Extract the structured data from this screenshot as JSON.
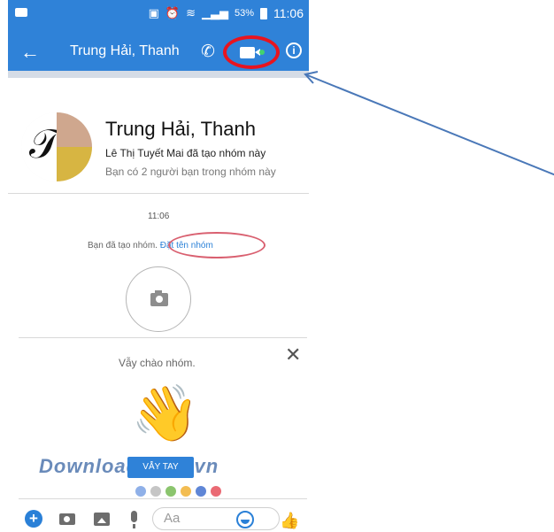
{
  "status_bar": {
    "battery": "53%",
    "time": "11:06"
  },
  "header": {
    "title": "Trung Hải, Thanh",
    "back_icon": "arrow-left",
    "phone_icon": "phone",
    "video_icon": "video-camera",
    "info_icon": "info"
  },
  "group": {
    "name": "Trung Hải, Thanh",
    "creator_note": "Lê Thị Tuyết Mai đã tạo nhóm này",
    "friends_note": "Bạn có 2 người bạn trong nhóm này"
  },
  "conversation": {
    "timestamp": "11:06",
    "created_text": "Bạn đã tạo nhóm.",
    "name_group_link": "Đặt tên nhóm"
  },
  "wave": {
    "prompt": "Vẫy chào nhóm.",
    "button_label": "VẪY TAY",
    "close_icon": "close"
  },
  "watermark": "Download.com.vn",
  "color_dots": [
    "#8fb0e8",
    "#c5c5c5",
    "#8bc56e",
    "#f3bd52",
    "#5f86d6",
    "#ea6a74"
  ],
  "composer": {
    "placeholder": "Aa",
    "icons": [
      "plus",
      "camera",
      "image",
      "microphone",
      "emoji",
      "thumbs-up"
    ]
  },
  "colors": {
    "header_blue": "#2f82d8",
    "highlight_red": "#e8141f",
    "link_blue": "#2a80d7",
    "annotation_arrow": "#4a78b8"
  }
}
